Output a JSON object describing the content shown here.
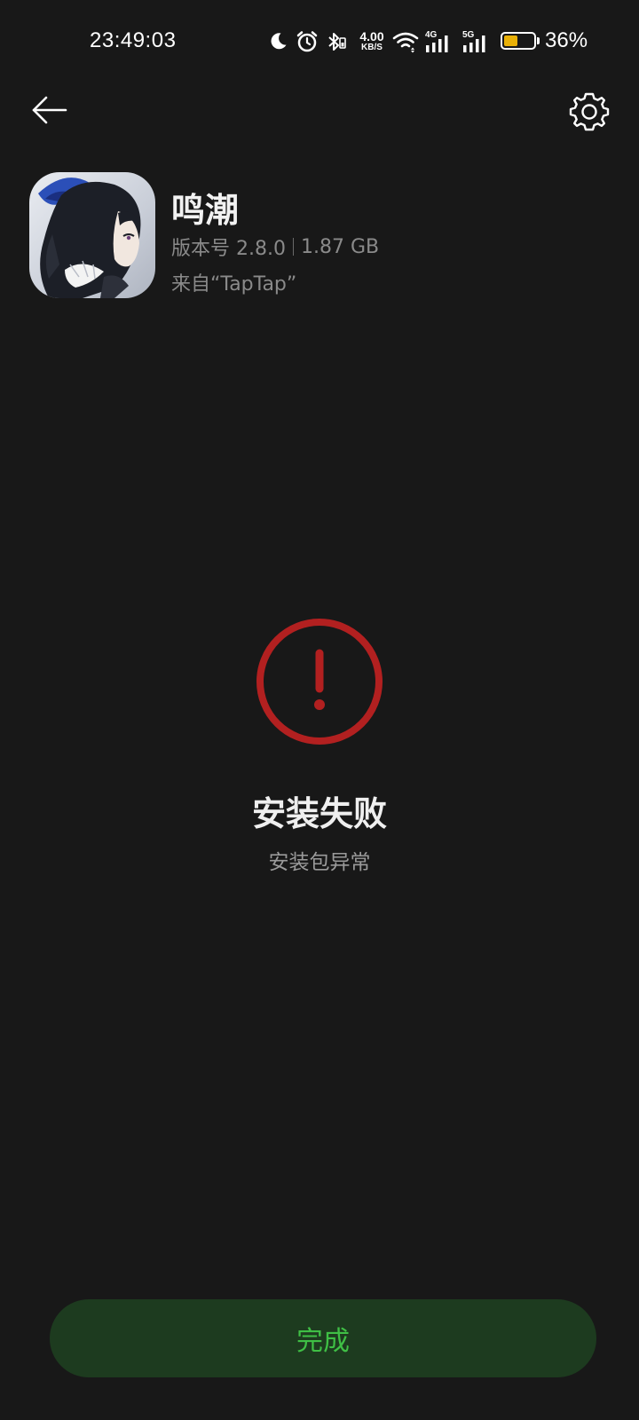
{
  "status_bar": {
    "time": "23:49:03",
    "net_speed_value": "4.00",
    "net_speed_unit": "KB/S",
    "sim1_label": "4G",
    "sim2_label": "5G",
    "battery_percent_text": "36%",
    "battery_level": 0.36,
    "battery_color": "#e8b007",
    "icons": [
      "moon-icon",
      "alarm-icon",
      "bluetooth-icon",
      "wifi-icon",
      "signal-icon",
      "battery-icon"
    ]
  },
  "nav": {
    "back_icon": "arrow-left-icon",
    "settings_icon": "gear-icon"
  },
  "app": {
    "name": "鸣潮",
    "version": "版本号 2.8.0",
    "size": "1.87 GB",
    "source": "来自“TapTap”"
  },
  "result": {
    "icon": "error-exclamation-icon",
    "icon_color": "#b22020",
    "title": "安装失败",
    "subtitle": "安装包异常"
  },
  "actions": {
    "done_label": "完成",
    "done_bg": "#1d3b1f",
    "done_text_color": "#3fbf45"
  }
}
